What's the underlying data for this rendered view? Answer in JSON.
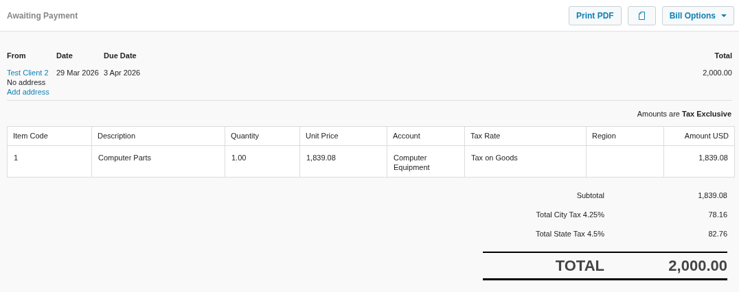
{
  "header": {
    "status": "Awaiting Payment",
    "buttons": [
      {
        "kind": "text",
        "label": "Print PDF"
      },
      {
        "kind": "icon"
      },
      {
        "kind": "dropdown",
        "label": "Bill Options"
      }
    ]
  },
  "summary": {
    "columns": [
      {
        "heading": "From",
        "lines": [
          {
            "kind": "link",
            "text": "Test Client 2"
          },
          {
            "kind": "text",
            "text": "No address"
          },
          {
            "kind": "link",
            "text": "Add address"
          }
        ]
      },
      {
        "heading": "Date",
        "lines": [
          {
            "kind": "text",
            "text": "29 Mar 2026"
          }
        ]
      },
      {
        "heading": "Due Date",
        "lines": [
          {
            "kind": "text",
            "text": "3 Apr 2026"
          }
        ]
      }
    ],
    "total": {
      "heading": "Total",
      "value": "2,000.00"
    }
  },
  "tax_note": "Amounts are **Tax Exclusive**",
  "table": {
    "columns": [
      "Item Code",
      "Description",
      "Quantity",
      "Unit Price",
      "Account",
      "Tax Rate",
      "Region",
      "Amount USD"
    ],
    "rows": [
      [
        "1",
        "Computer Parts",
        "1.00",
        "1,839.08",
        "Computer Equipment",
        "Tax on Goods",
        "",
        "1,839.08"
      ]
    ]
  },
  "totals": [
    {
      "label": "Subtotal",
      "value": "1,839.08"
    },
    {
      "label": "Total City Tax 4.25%",
      "value": "78.16"
    },
    {
      "label": "Total State Tax 4.5%",
      "value": "82.76"
    }
  ],
  "grand_total": {
    "label": "TOTAL",
    "value": "2,000.00"
  }
}
